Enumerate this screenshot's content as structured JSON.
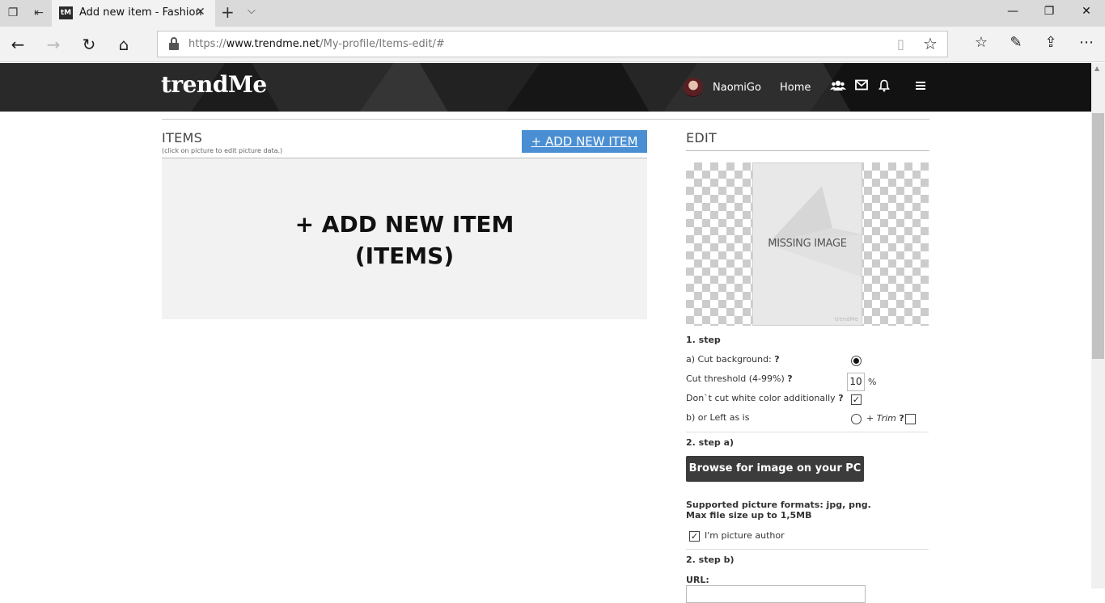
{
  "browser": {
    "tab_favicon": "tM",
    "tab_title": "Add new item - Fashion",
    "url_prefix": "https://",
    "url_host": "www.trendme.net",
    "url_path": "/My-profile/Items-edit/#"
  },
  "header": {
    "logo": "trendMe",
    "username": "NaomiGo",
    "home_label": "Home"
  },
  "items": {
    "title": "ITEMS",
    "hint": "(click on picture to edit picture data.)",
    "add_button": "+ ADD NEW ITEM",
    "placeholder_line1": "+ ADD NEW ITEM",
    "placeholder_line2": "(ITEMS)"
  },
  "edit": {
    "title": "EDIT",
    "missing_image_text": "MISSING IMAGE",
    "missing_image_brand": "trendMe",
    "step1": {
      "heading": "1. step",
      "cut_background_label": "a) Cut background:",
      "cut_background_checked": true,
      "threshold_label": "Cut threshold (4-99%)",
      "threshold_value": "10",
      "threshold_unit": "%",
      "dont_cut_white_label": "Don`t cut white color additionally",
      "dont_cut_white_checked": true,
      "left_as_is_label": "b) or Left as is",
      "left_as_is_checked": false,
      "trim_label": "+ Trim",
      "trim_checked": false,
      "help_mark": "?"
    },
    "step2a": {
      "heading": "2. step a)",
      "browse_button": "Browse for image on your PC",
      "formats_line1": "Supported picture formats: jpg, png.",
      "formats_line2": "Max file size up to 1,5MB",
      "author_label": "I'm picture author",
      "author_checked": true
    },
    "step2b": {
      "heading": "2. step b)",
      "url_label": "URL:"
    }
  }
}
